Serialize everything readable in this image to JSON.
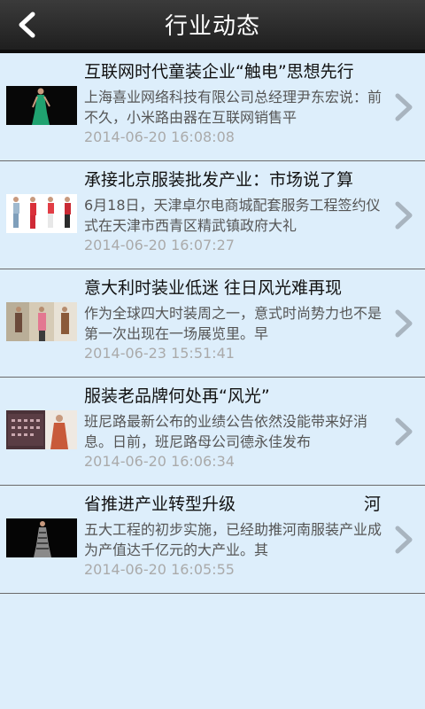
{
  "header": {
    "title": "行业动态",
    "back_icon": "back-arrow-icon"
  },
  "items": [
    {
      "title": "互联网时代童装企业“触电”思想先行",
      "summary": "上海喜业网络科技有限公司总经理尹东宏说：前不久，小米路由器在互联网销售平",
      "time": "2014-06-20 16:08:08",
      "thumbnail": "woman-green-dress-thumbnail"
    },
    {
      "title": "承接北京服装批发产业：市场说了算",
      "summary": "6月18日，天津卓尔电商城配套服务工程签约仪式在天津市西青区精武镇政府大礼",
      "time": "2014-06-20 16:07:27",
      "thumbnail": "four-models-thumbnail"
    },
    {
      "title": "意大利时装业低迷 往日风光难再现",
      "summary": "作为全球四大时装周之一，意式时尚势力也不是第一次出现在一场展览里。早",
      "time": "2014-06-23 15:51:41",
      "thumbnail": "fashion-street-thumbnail"
    },
    {
      "title": "服装老品牌何处再“风光”",
      "summary": "班尼路最新公布的业绩公告依然没能带来好消息。日前，班尼路母公司德永佳发布",
      "time": "2014-06-20 16:06:34",
      "thumbnail": "calendar-model-thumbnail"
    },
    {
      "title": "省推进产业转型升级",
      "title_right": "河",
      "summary": "五大工程的初步实施，已经助推河南服装产业成为产值达千亿元的大产业。其",
      "time": "2014-06-20 16:05:55",
      "thumbnail": "model-black-dress-thumbnail"
    }
  ]
}
